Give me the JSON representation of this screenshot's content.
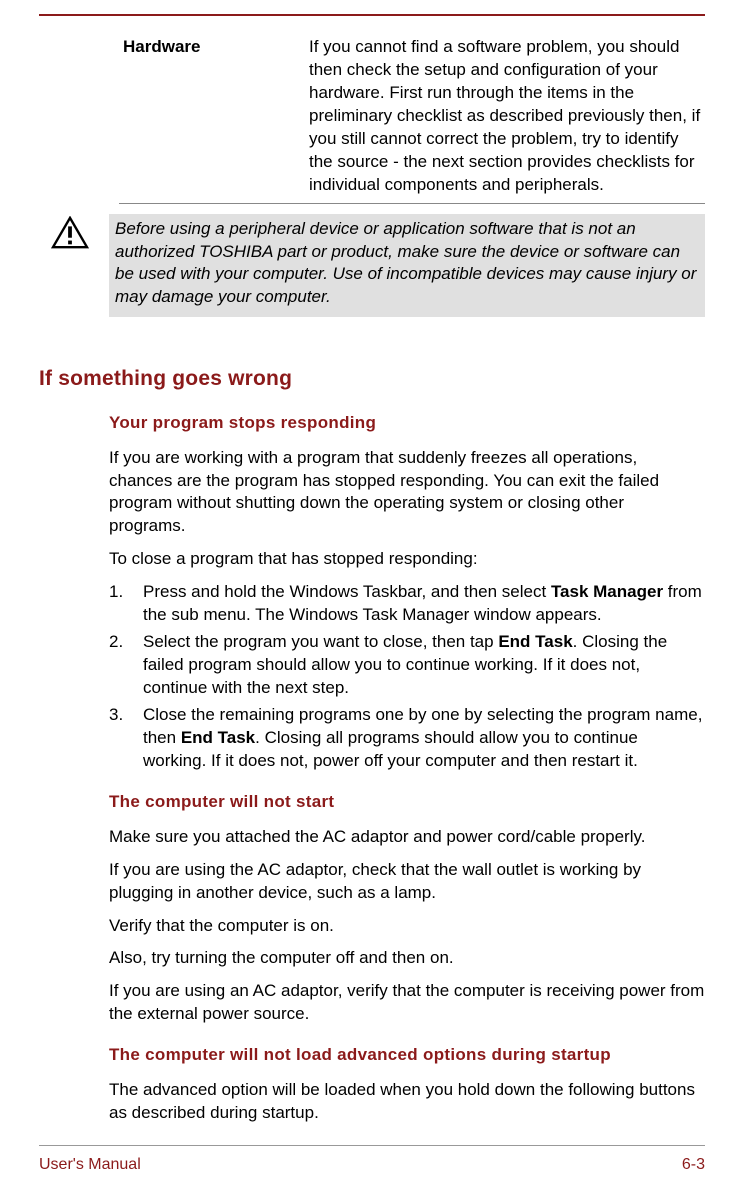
{
  "table": {
    "label": "Hardware",
    "desc": "If you cannot find a software problem, you should then check the setup and configuration of your hardware. First run through the items in the preliminary checklist as described previously then, if you still cannot correct the problem, try to identify the source - the next section provides checklists for individual components and peripherals."
  },
  "callout": "Before using a peripheral device or application software that is not an authorized TOSHIBA part or product, make sure the device or software can be used with your computer. Use of incompatible devices may cause injury or may damage your computer.",
  "h2": "If something goes wrong",
  "sec1": {
    "title": "Your program stops responding",
    "p1": "If you are working with a program that suddenly freezes all operations, chances are the program has stopped responding. You can exit the failed program without shutting down the operating system or closing other programs.",
    "p2": "To close a program that has stopped responding:",
    "li1a": "Press and hold the Windows Taskbar, and then select ",
    "li1b": "Task Manager",
    "li1c": " from the sub menu. The Windows Task Manager window appears.",
    "li2a": "Select the program you want to close, then tap ",
    "li2b": "End Task",
    "li2c": ". Closing the failed program should allow you to continue working. If it does not, continue with the next step.",
    "li3a": "Close the remaining programs one by one by selecting the program name, then ",
    "li3b": "End Task",
    "li3c": ". Closing all programs should allow you to continue working. If it does not, power off your computer and then restart it."
  },
  "sec2": {
    "title": "The computer will not start",
    "p1": "Make sure you attached the AC adaptor and power cord/cable properly.",
    "p2": "If you are using the AC adaptor, check that the wall outlet is working by plugging in another device, such as a lamp.",
    "p3": "Verify that the computer is on.",
    "p4": "Also, try turning the computer off and then on.",
    "p5": "If you are using an AC adaptor, verify that the computer is receiving power from the external power source."
  },
  "sec3": {
    "title": "The computer will not load advanced options during startup",
    "p1": "The advanced option will be loaded when you hold down the following buttons as described during startup."
  },
  "footer": {
    "left": "User's Manual",
    "right": "6-3"
  }
}
